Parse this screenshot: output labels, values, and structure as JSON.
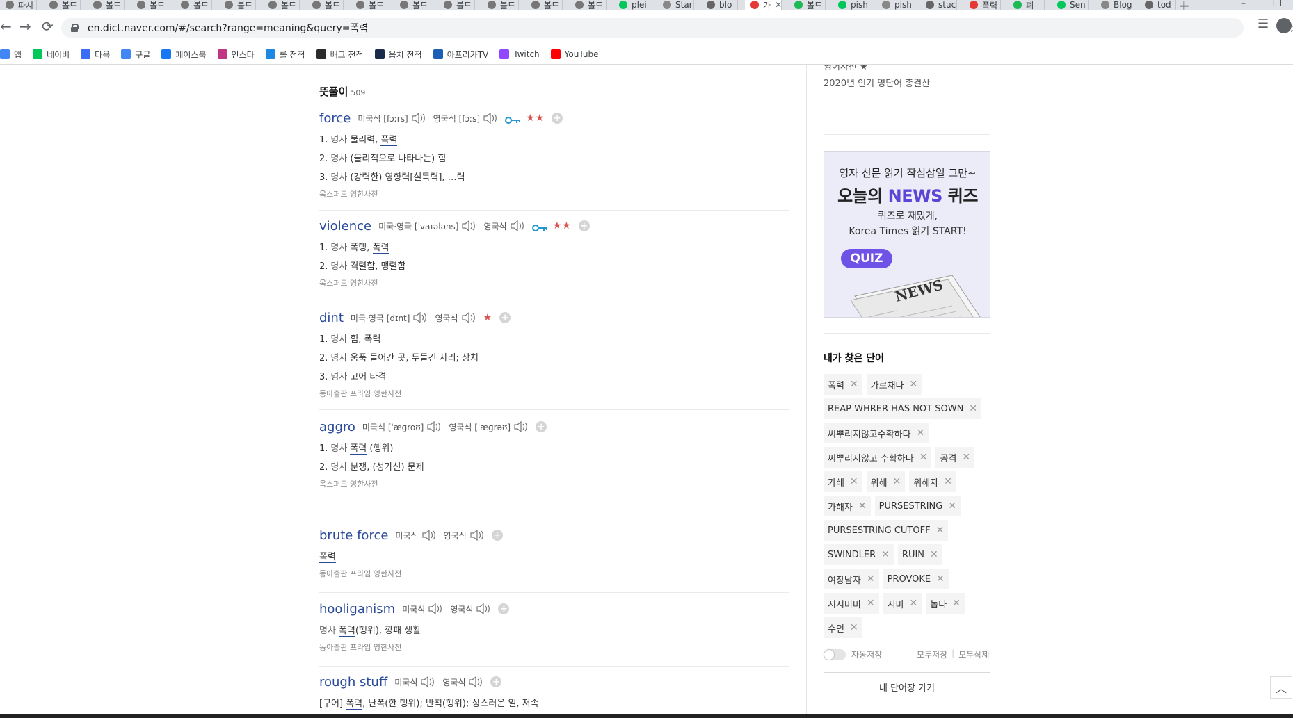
{
  "browser": {
    "tabs": [
      {
        "label": "파시"
      },
      {
        "label": "볼드"
      },
      {
        "label": "볼드"
      },
      {
        "label": "볼드"
      },
      {
        "label": "볼드"
      },
      {
        "label": "볼드"
      },
      {
        "label": "볼드"
      },
      {
        "label": "볼드"
      },
      {
        "label": "볼드"
      },
      {
        "label": "볼드"
      },
      {
        "label": "볼드"
      },
      {
        "label": "볼드"
      },
      {
        "label": "볼드"
      },
      {
        "label": "볼드"
      },
      {
        "label": "plei"
      },
      {
        "label": "Star"
      },
      {
        "label": "blo"
      },
      {
        "label": "가"
      },
      {
        "label": "볼드"
      },
      {
        "label": "pish"
      },
      {
        "label": "pish"
      },
      {
        "label": "stuc"
      },
      {
        "label": "폭력"
      },
      {
        "label": "폐"
      },
      {
        "label": "Sen"
      },
      {
        "label": "Blog"
      },
      {
        "label": "tod"
      }
    ],
    "url": "en.dict.naver.com/#/search?range=meaning&query=폭력",
    "bookmarks": [
      {
        "label": "앱",
        "icon": "apps-grid-icon",
        "color": "#4285f4"
      },
      {
        "label": "네이버",
        "icon": "naver-icon",
        "color": "#03c75a"
      },
      {
        "label": "다음",
        "icon": "daum-icon",
        "color": "#3a6cf4"
      },
      {
        "label": "구글",
        "icon": "google-icon",
        "color": "#4285f4"
      },
      {
        "label": "페이스북",
        "icon": "facebook-icon",
        "color": "#1877f2"
      },
      {
        "label": "인스타",
        "icon": "instagram-icon",
        "color": "#c13584"
      },
      {
        "label": "롤 전적",
        "icon": "op-gg-icon",
        "color": "#1e88e5"
      },
      {
        "label": "배그 전적",
        "icon": "pubg-icon",
        "color": "#2b2b2b"
      },
      {
        "label": "옵치 전적",
        "icon": "overwatch-icon",
        "color": "#1a2b4c"
      },
      {
        "label": "아프리카TV",
        "icon": "afreecatv-icon",
        "color": "#1a5fb4"
      },
      {
        "label": "Twitch",
        "icon": "twitch-icon",
        "color": "#9146ff"
      },
      {
        "label": "YouTube",
        "icon": "youtube-icon",
        "color": "#ff0000"
      }
    ]
  },
  "results": {
    "section_title": "뜻풀이",
    "count": "509",
    "entries": [
      {
        "word": "force",
        "pron": [
          {
            "label": "미국식 [fɔːrs]"
          },
          {
            "label": "영국식 [fɔːs]"
          }
        ],
        "key": true,
        "stars": "★★",
        "defs": [
          {
            "num": "1.",
            "pos": "명사",
            "text": "물리력, ",
            "hl": "폭력",
            "after": ""
          },
          {
            "num": "2.",
            "pos": "명사",
            "text": "(물리적으로 나타나는) 힘",
            "hl": "",
            "after": ""
          },
          {
            "num": "3.",
            "pos": "명사",
            "text": "(강력한) 영향력[설득력], …력",
            "hl": "",
            "after": ""
          }
        ],
        "source": "옥스퍼드 영한사전"
      },
      {
        "word": "violence",
        "pron": [
          {
            "label": "미국·영국 [ˈvaɪələns]"
          },
          {
            "label": "영국식"
          }
        ],
        "key": true,
        "stars": "★★",
        "defs": [
          {
            "num": "1.",
            "pos": "명사",
            "text": "폭행, ",
            "hl": "폭력",
            "after": ""
          },
          {
            "num": "2.",
            "pos": "명사",
            "text": "격렬함, 맹렬함",
            "hl": "",
            "after": ""
          }
        ],
        "source": "옥스퍼드 영한사전"
      },
      {
        "word": "dint",
        "pron": [
          {
            "label": "미국·영국 [dɪnt]"
          },
          {
            "label": "영국식"
          }
        ],
        "key": false,
        "stars": "★",
        "defs": [
          {
            "num": "1.",
            "pos": "명사",
            "text": "힘, ",
            "hl": "폭력",
            "after": ""
          },
          {
            "num": "2.",
            "pos": "명사",
            "text": "움푹 들어간 곳, 두들긴 자리; 상처",
            "hl": "",
            "after": ""
          },
          {
            "num": "3.",
            "pos": "명사",
            "text": "고어 타격",
            "hl": "",
            "after": ""
          }
        ],
        "source": "동아출판 프라임 영한사전"
      },
      {
        "word": "aggro",
        "pron": [
          {
            "label": "미국식 [ˈæɡroʊ]"
          },
          {
            "label": "영국식 [ˈæɡrəʊ]"
          }
        ],
        "key": false,
        "stars": "",
        "defs": [
          {
            "num": "1.",
            "pos": "명사",
            "text": "",
            "hl": "폭력",
            "after": " (행위)"
          },
          {
            "num": "2.",
            "pos": "명사",
            "text": "분쟁, (성가신) 문제",
            "hl": "",
            "after": ""
          }
        ],
        "source": "옥스퍼드 영한사전"
      },
      {
        "word": "brute force",
        "pron": [
          {
            "label": "미국식"
          },
          {
            "label": "영국식"
          }
        ],
        "key": false,
        "stars": "",
        "defs": [
          {
            "num": "",
            "pos": "",
            "text": "",
            "hl": "폭력",
            "after": ""
          }
        ],
        "source": "동아출판 프라임 영한사전"
      },
      {
        "word": "hooliganism",
        "pron": [
          {
            "label": "미국식"
          },
          {
            "label": "영국식"
          }
        ],
        "key": false,
        "stars": "",
        "defs": [
          {
            "num": "",
            "pos": "명사",
            "text": "",
            "hl": "폭력",
            "after": "(행위), 깡패 생활"
          }
        ],
        "source": "동아출판 프라임 영한사전"
      },
      {
        "word": "rough stuff",
        "pron": [
          {
            "label": "미국식"
          },
          {
            "label": "영국식"
          }
        ],
        "key": false,
        "stars": "",
        "defs": [
          {
            "num": "",
            "pos": "",
            "text": "[구어] ",
            "hl": "폭력",
            "after": ", 난폭(한 행위); 반칙(행위); 상스러운 일, 저속"
          }
        ],
        "source": "동아출판 프라임 영한사전"
      }
    ]
  },
  "sidebar": {
    "cut_heading": "영어사전 ★",
    "promo_link": "2020년 인기 영단어 총결산",
    "ad": {
      "line1": "영자 신문 읽기 작심삼일 그만~",
      "line2_prefix": "오늘의 ",
      "line2_highlight": "NEWS",
      "line2_suffix": " 퀴즈",
      "line3": "퀴즈로 재밌게,",
      "line4": "Korea Times 읽기 START!",
      "badge": "QUIZ",
      "paper_word": "NEWS"
    },
    "my_words_title": "내가 찾은 단어",
    "my_words": [
      "폭력",
      "가로채다",
      "REAP WHRER HAS NOT SOWN",
      "씨뿌리지않고수확하다",
      "씨뿌리지않고 수확하다",
      "공격",
      "가해",
      "위해",
      "위해자",
      "가해자",
      "PURSESTRING",
      "PURSESTRING CUTOFF",
      "SWINDLER",
      "RUIN",
      "여장남자",
      "PROVOKE",
      "시시비비",
      "시비",
      "놉다",
      "수면"
    ],
    "autosave_label": "자동저장",
    "save_all": "모두저장",
    "delete_all": "모두삭제",
    "goto_wordbook": "내 단어장 가기"
  },
  "colors": {
    "word_link": "#2a4a9a",
    "star": "#d9534f",
    "key": "#2196d3",
    "ad_accent": "#5b45d6"
  }
}
